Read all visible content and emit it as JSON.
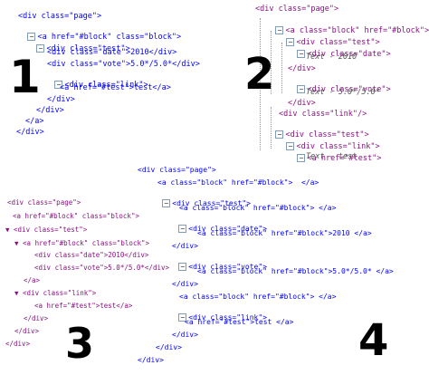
{
  "panel1": {
    "number": "1",
    "lines": [
      "<div class=\"page\">",
      "<a href=\"#block\" class=\"block\">",
      "<div class=\"test\">",
      "<div class=\"date\">2010</div>",
      "<div class=\"vote\">5.0*/5.0*</div>",
      "<div class=\"link\">",
      "<a href=\"#test\">test</a>",
      "</div>",
      "</div>",
      "</a>",
      "</div>"
    ],
    "expander": "−"
  },
  "panel2": {
    "number": "2",
    "lines": [
      "<div class=\"page\">",
      "<a class=\"block\" href=\"#block\">",
      "<div class=\"test\">",
      "<div class=\"date\">",
      "Text - 2010",
      "</div>",
      "<div class=\"vote\">",
      "Text - 5.0*/5.0*",
      "</div>",
      "<div class=\"link\"/>",
      "<div class=\"test\">",
      "<div class=\"link\">",
      "<a href=\"#test\">",
      "Text - test",
      "</A/>"
    ],
    "expander": "−"
  },
  "panel3": {
    "number": "3",
    "lines": [
      "<div class=\"page\">",
      "<a href=\"#block\" class=\"block\">",
      "▼ <div class=\"test\">",
      "▼ <a href=\"#block\" class=\"block\">",
      "<div class=\"date\">2010</div>",
      "<div class=\"vote\">5.0*/5.0*</div>",
      "</a>",
      "▼ <div class=\"link\">",
      "<a href=\"#test\">test</a>",
      "</div>",
      "</div>",
      "</div>"
    ]
  },
  "panel4": {
    "number": "4",
    "lines": [
      "<div class=\"page\">",
      "<a class=\"block\" href=\"#block\">  </a>",
      "<div class=\"test\">",
      "<a class=\"block\" href=\"#block\"> </a>",
      "<div class=\"date\">",
      "<a class=\"block\" href=\"#block\">2010 </a>",
      "</div>",
      "<div class=\"vote\">",
      "<a class=\"block\" href=\"#block\">5.0*/5.0* </a>",
      "</div>",
      "<a class=\"block\" href=\"#block\"> </a>",
      "<div class=\"link\">",
      "<a href=\"#test\">test </a>",
      "</div>",
      "</div>",
      "</div>"
    ],
    "expander": "−"
  }
}
